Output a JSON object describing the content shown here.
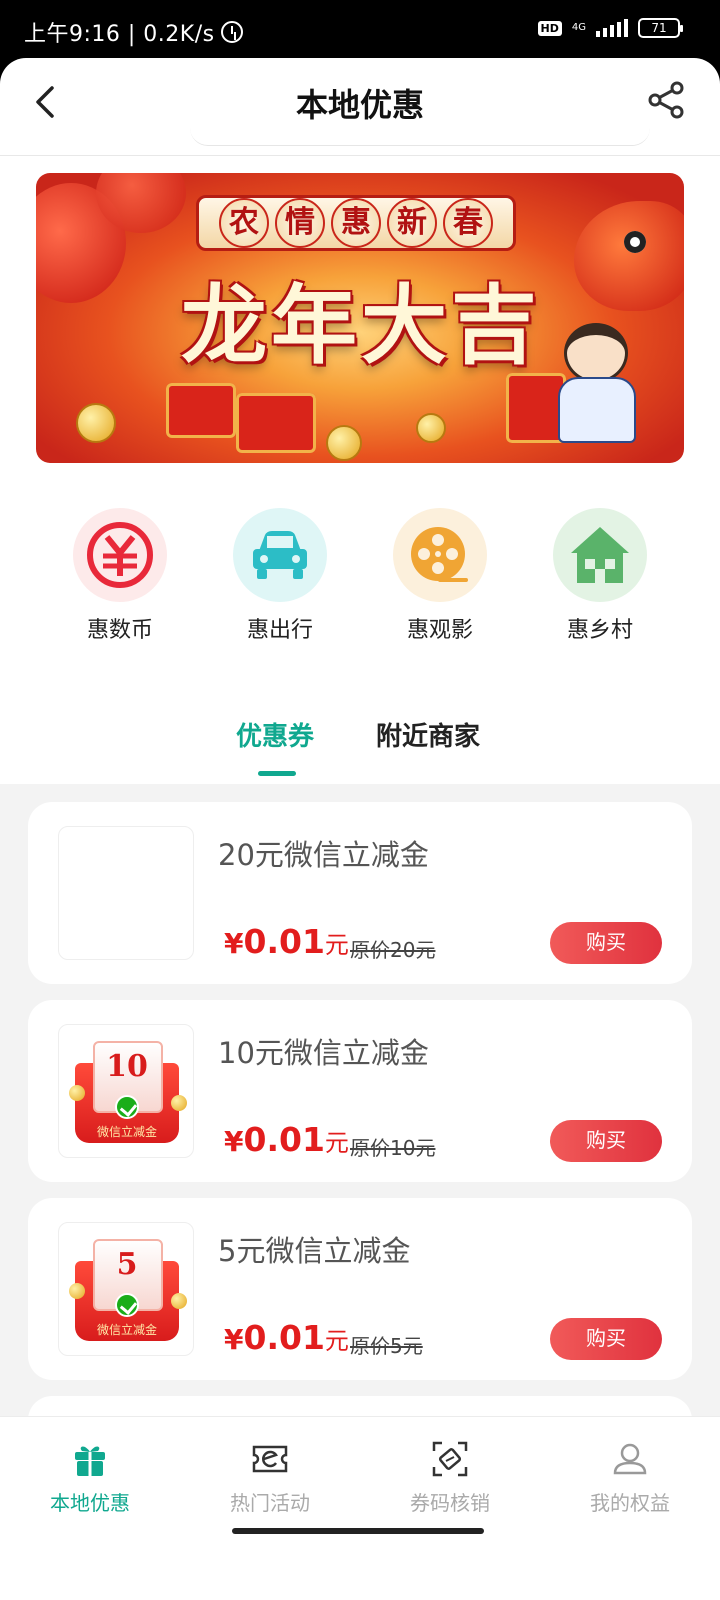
{
  "status_bar": {
    "left_text": "上午9:16 | 0.2K/s",
    "hd": "HD",
    "network": "4G",
    "battery": "71"
  },
  "header": {
    "title": "本地优惠"
  },
  "banner": {
    "top_chars": [
      "农",
      "情",
      "惠",
      "新",
      "春"
    ],
    "main_text": "龙年大吉"
  },
  "categories": [
    {
      "label": "惠数币",
      "icon": "yuan-coin-icon",
      "color": "#e8293a"
    },
    {
      "label": "惠出行",
      "icon": "car-icon",
      "color": "#2cbdc6"
    },
    {
      "label": "惠观影",
      "icon": "film-reel-icon",
      "color": "#f0a534"
    },
    {
      "label": "惠乡村",
      "icon": "house-icon",
      "color": "#5ab36a"
    }
  ],
  "tabs": [
    {
      "label": "优惠券",
      "active": true
    },
    {
      "label": "附近商家",
      "active": false
    }
  ],
  "coupons": [
    {
      "title": "20元微信立减金",
      "yen": "¥",
      "price": "0.01",
      "unit": "元",
      "original": "原价20元",
      "buy": "购买",
      "badge_value": "",
      "badge_label": ""
    },
    {
      "title": "10元微信立减金",
      "yen": "¥",
      "price": "0.01",
      "unit": "元",
      "original": "原价10元",
      "buy": "购买",
      "badge_value": "10",
      "badge_label": "微信立减金"
    },
    {
      "title": "5元微信立减金",
      "yen": "¥",
      "price": "0.01",
      "unit": "元",
      "original": "原价5元",
      "buy": "购买",
      "badge_value": "5",
      "badge_label": "微信立减金"
    }
  ],
  "bottom_nav": [
    {
      "label": "本地优惠",
      "icon": "gift-icon",
      "active": true
    },
    {
      "label": "热门活动",
      "icon": "ticket-e-icon",
      "active": false
    },
    {
      "label": "券码核销",
      "icon": "scan-ticket-icon",
      "active": false
    },
    {
      "label": "我的权益",
      "icon": "user-icon",
      "active": false
    }
  ],
  "colors": {
    "accent": "#10a88f",
    "price": "#e21d1d",
    "buy_button": "#e0323e"
  }
}
